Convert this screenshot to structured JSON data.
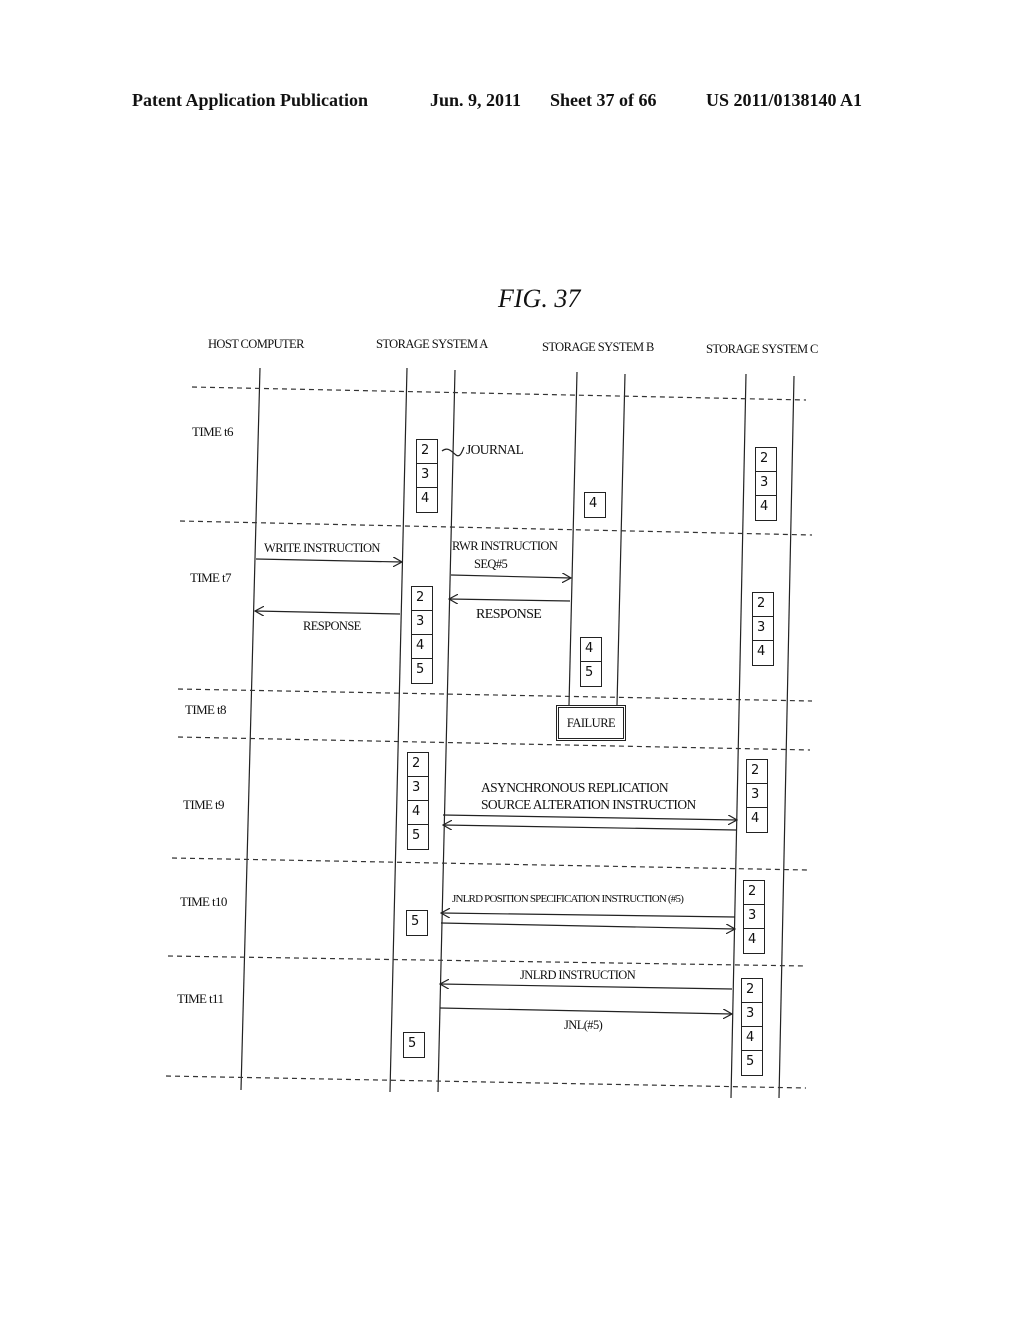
{
  "header": {
    "publication": "Patent Application Publication",
    "date": "Jun. 9, 2011",
    "sheet": "Sheet 37 of 66",
    "pub_number": "US 2011/0138140 A1"
  },
  "figure": {
    "title": "FIG. 37",
    "columns": [
      {
        "id": "host",
        "label": "HOST COMPUTER"
      },
      {
        "id": "A",
        "label": "STORAGE SYSTEM A"
      },
      {
        "id": "B",
        "label": "STORAGE SYSTEM B"
      },
      {
        "id": "C",
        "label": "STORAGE SYSTEM C"
      }
    ],
    "time_steps": [
      {
        "label": "TIME t6"
      },
      {
        "label": "TIME t7"
      },
      {
        "label": "TIME t8"
      },
      {
        "label": "TIME t9"
      },
      {
        "label": "TIME t10"
      },
      {
        "label": "TIME t11"
      }
    ],
    "journal_label": "JOURNAL",
    "failure_label": "FAILURE",
    "messages": {
      "write_instruction": "WRITE INSTRUCTION",
      "response_host": "RESPONSE",
      "rwr_instruction": "RWR INSTRUCTION",
      "seq5": "SEQ#5",
      "response_b": "RESPONSE",
      "async_line1": "ASYNCHRONOUS REPLICATION",
      "async_line2": "SOURCE ALTERATION INSTRUCTION",
      "jnlrd_position": "JNLRD POSITION SPECIFICATION INSTRUCTION (#5)",
      "jnlrd_instruction": "JNLRD INSTRUCTION",
      "jnl5": "JNL(#5)"
    },
    "journals": {
      "t6_A": [
        "2",
        "3",
        "4"
      ],
      "t6_B": [
        "4"
      ],
      "t6_C": [
        "2",
        "3",
        "4"
      ],
      "t7_A": [
        "2",
        "3",
        "4",
        "5"
      ],
      "t7_B": [
        "4",
        "5"
      ],
      "t7_C": [
        "2",
        "3",
        "4"
      ],
      "t9_A": [
        "2",
        "3",
        "4",
        "5"
      ],
      "t9_C": [
        "2",
        "3",
        "4"
      ],
      "t10_A": [
        "5"
      ],
      "t10_C": [
        "2",
        "3",
        "4"
      ],
      "t11_A": [
        "5"
      ],
      "t11_C": [
        "2",
        "3",
        "4",
        "5"
      ]
    }
  }
}
